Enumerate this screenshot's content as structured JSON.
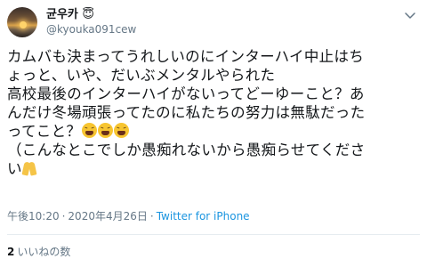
{
  "author": {
    "display_name": "균우카",
    "display_name_emoji": "angel-emoji",
    "handle": "@kyouka091cew",
    "avatar": "sunset-photo"
  },
  "tweet": {
    "lines": [
      "カムバも決まってうれしいのにインターハイ中止はち",
      "ょっと、いや、だいぶメンタルやられた",
      "高校最後のインターハイがないってどーゆーこと？あ",
      "んだけ冬場頑張ってたのに私たちの努力は無駄だった",
      "ってこと？",
      "（こんなとこでしか愚痴れないから愚痴らせてくださ",
      "い"
    ],
    "emojis": [
      "tired-face-emoji",
      "tired-face-emoji",
      "tired-face-emoji",
      "folded-hands-emoji"
    ]
  },
  "meta": {
    "time": "午後10:20",
    "separator": "·",
    "date": "2020年4月26日",
    "source": "Twitter for iPhone"
  },
  "likes": {
    "count": "2",
    "label": "いいねの数"
  },
  "colors": {
    "text": "#14171a",
    "muted": "#657786",
    "link": "#1b95e0",
    "divider": "#e6ecf0"
  }
}
